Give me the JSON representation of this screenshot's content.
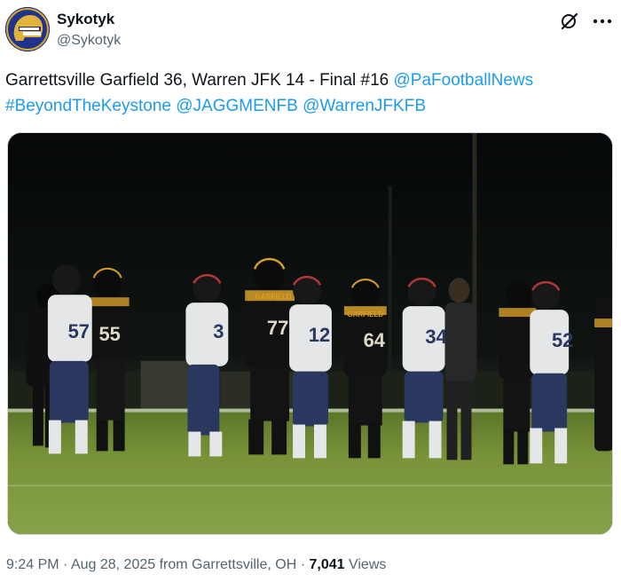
{
  "author": {
    "display_name": "Sykotyk",
    "handle": "@Sykotyk",
    "avatar_icon": "helmet-logo-icon"
  },
  "actions": {
    "grok_icon": "grok-icon",
    "more_icon": "more-options-icon"
  },
  "tweet": {
    "text_plain": "Garrettsville Garfield 36, Warren JFK 14 - Final #16 ",
    "mention_pafootballnews": "@PaFootballNews",
    "hashtag_beyondthekeystone": "#BeyondTheKeystone",
    "mention_jaggmenfb": "@JAGGMENFB",
    "mention_warrenjfkfb": "@WarrenJFKFB"
  },
  "media": {
    "jersey_numbers": [
      "57",
      "55",
      "3",
      "77",
      "12",
      "64",
      "34",
      "52"
    ],
    "jersey_text": "GARFIELD"
  },
  "meta": {
    "time": "9:24 PM",
    "separator": " · ",
    "date": "Aug 28, 2025",
    "location": " from Garrettsville, OH",
    "views_count": "7,041",
    "views_label": " Views"
  },
  "colors": {
    "link": "#1d9bf0",
    "secondary_text": "#536471",
    "primary_text": "#0f1419",
    "garfield_black": "#111111",
    "garfield_gold": "#e0a62a",
    "jfk_white": "#eef0f2",
    "jfk_navy": "#2c3a63",
    "field_green": "#7f9a3c"
  }
}
